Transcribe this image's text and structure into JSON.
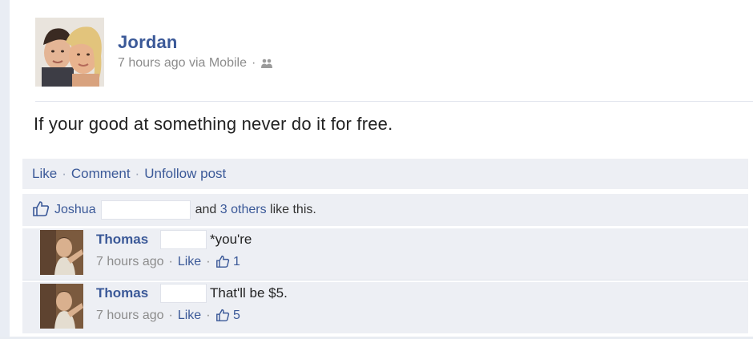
{
  "post": {
    "author": "Jordan",
    "time": "7 hours ago via Mobile",
    "meta_dot": "·",
    "text": "If your good at something never do it for free."
  },
  "actions": {
    "like": "Like",
    "comment": "Comment",
    "unfollow": "Unfollow post",
    "dot": "·"
  },
  "likes": {
    "first_name": "Joshua",
    "and_label": "and",
    "others": "3 others",
    "suffix": "like this."
  },
  "comments": [
    {
      "name": "Thomas",
      "text": "*you're",
      "time": "7 hours ago",
      "like_label": "Like",
      "like_count": "1"
    },
    {
      "name": "Thomas",
      "text": "That'll be $5.",
      "time": "7 hours ago",
      "like_label": "Like",
      "like_count": "5"
    }
  ],
  "icons": {
    "audience": "friends-icon",
    "like": "thumbs-up-icon"
  },
  "colors": {
    "link": "#3b5998",
    "panel": "#edeff4",
    "meta": "#8c8c8c"
  }
}
